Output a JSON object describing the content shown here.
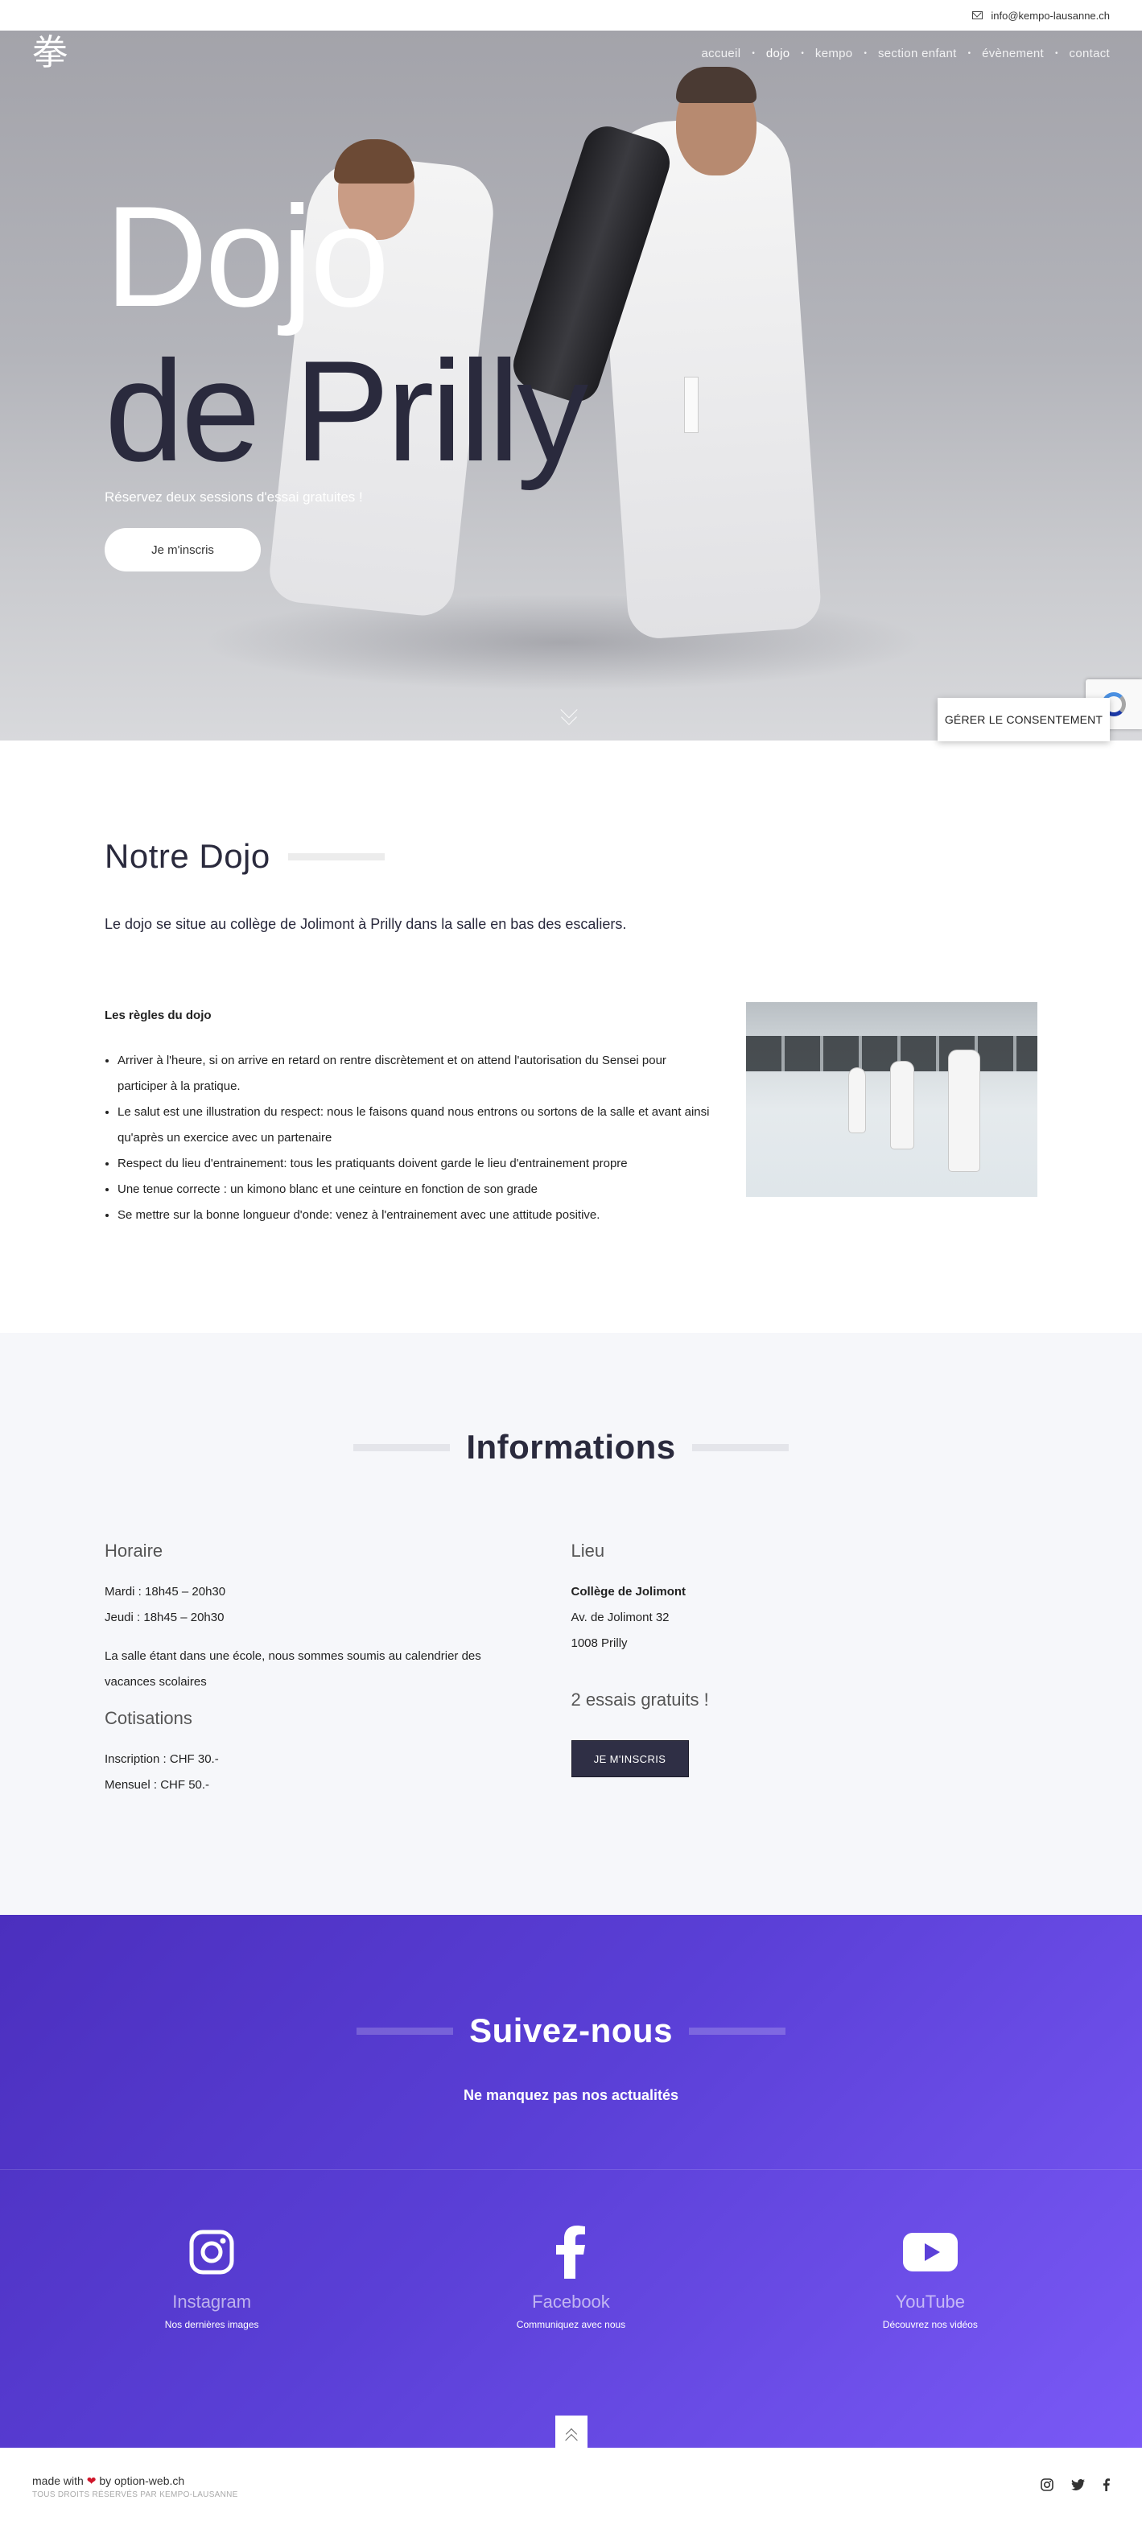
{
  "topbar": {
    "email": "info@kempo-lausanne.ch"
  },
  "nav": {
    "logo": "拳",
    "items": [
      {
        "label": "accueil",
        "active": false
      },
      {
        "label": "dojo",
        "active": true
      },
      {
        "label": "kempo",
        "active": false
      },
      {
        "label": "section enfant",
        "active": false
      },
      {
        "label": "évènement",
        "active": false
      },
      {
        "label": "contact",
        "active": false
      }
    ]
  },
  "hero": {
    "title_line1": "Dojo",
    "title_line2": "de Prilly",
    "subtitle": "Réservez deux sessions d'essai gratuites !",
    "button": "Je m'inscris"
  },
  "consent": {
    "button": "GÉRER LE CONSENTEMENT"
  },
  "dojo": {
    "title": "Notre Dojo",
    "lead": "Le dojo se situe au collège de Jolimont à Prilly dans la salle en bas des escaliers.",
    "rules_title": "Les règles du dojo",
    "rules": [
      "Arriver à l'heure, si on arrive en retard on rentre discrètement et on attend l'autorisation du Sensei pour participer à la pratique.",
      "Le salut est une illustration du respect: nous le faisons quand nous entrons ou sortons de la salle et avant ainsi qu'après un exercice avec un partenaire",
      "Respect du lieu d'entrainement: tous les pratiquants doivent garde le lieu d'entrainement propre",
      "Une tenue correcte : un kimono blanc et une ceinture en fonction de son grade",
      "Se mettre sur la bonne longueur d'onde: venez à l'entrainement avec une attitude positive."
    ]
  },
  "info": {
    "title": "Informations",
    "horaire_title": "Horaire",
    "horaire": [
      "Mardi : 18h45 – 20h30",
      "Jeudi : 18h45 – 20h30"
    ],
    "horaire_note": "La salle étant dans une école, nous sommes soumis au calendrier des vacances scolaires",
    "cotisations_title": "Cotisations",
    "cotisations": [
      "Inscription : CHF 30.-",
      "Mensuel : CHF 50.-"
    ],
    "lieu_title": "Lieu",
    "lieu_name": "Collège de Jolimont",
    "lieu_address": [
      "Av. de Jolimont 32",
      "1008 Prilly"
    ],
    "essais": "2 essais gratuits !",
    "button": "JE M'INSCRIS"
  },
  "follow": {
    "title": "Suivez-nous",
    "subtitle": "Ne manquez pas nos actualités",
    "socials": [
      {
        "name": "Instagram",
        "desc": "Nos dernières images",
        "icon": "instagram-icon"
      },
      {
        "name": "Facebook",
        "desc": "Communiquez avec nous",
        "icon": "facebook-icon"
      },
      {
        "name": "YouTube",
        "desc": "Découvrez nos vidéos",
        "icon": "youtube-icon"
      }
    ]
  },
  "footer": {
    "made_prefix": "made with",
    "made_suffix": "by option-web.ch",
    "rights": "TOUS DROITS RÉSERVÉS PAR KEMPO-LAUSANNE"
  },
  "colors": {
    "dark": "#2a2a3d",
    "purple_start": "#4b2fbe",
    "purple_end": "#7a59f6",
    "heart": "#d0172b"
  }
}
